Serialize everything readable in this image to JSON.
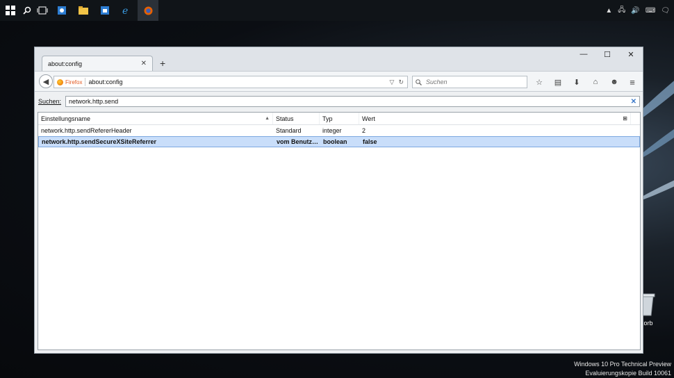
{
  "window": {
    "tab_title": "about:config",
    "caption_min": "—",
    "caption_max": "☐",
    "caption_close": "✕"
  },
  "navbar": {
    "identity_label": "Firefox",
    "url": "about:config",
    "search_placeholder": "Suchen"
  },
  "filter": {
    "label": "Suchen:",
    "value": "network.http.send"
  },
  "table": {
    "columns": [
      "Einstellungsname",
      "Status",
      "Typ",
      "Wert"
    ],
    "rows": [
      {
        "name": "network.http.sendRefererHeader",
        "status": "Standard",
        "type": "integer",
        "value": "2"
      },
      {
        "name": "network.http.sendSecureXSiteReferrer",
        "status": "vom Benutzer festgelegt",
        "type": "boolean",
        "value": "false"
      }
    ]
  },
  "desktop": {
    "bin_label": "korb",
    "watermark_line1": "Windows 10 Pro Technical Preview",
    "watermark_line2": "Evaluierungskopie Build 10061"
  },
  "colors": {
    "selection": "#c9defa",
    "accent": "#3a78c8"
  }
}
